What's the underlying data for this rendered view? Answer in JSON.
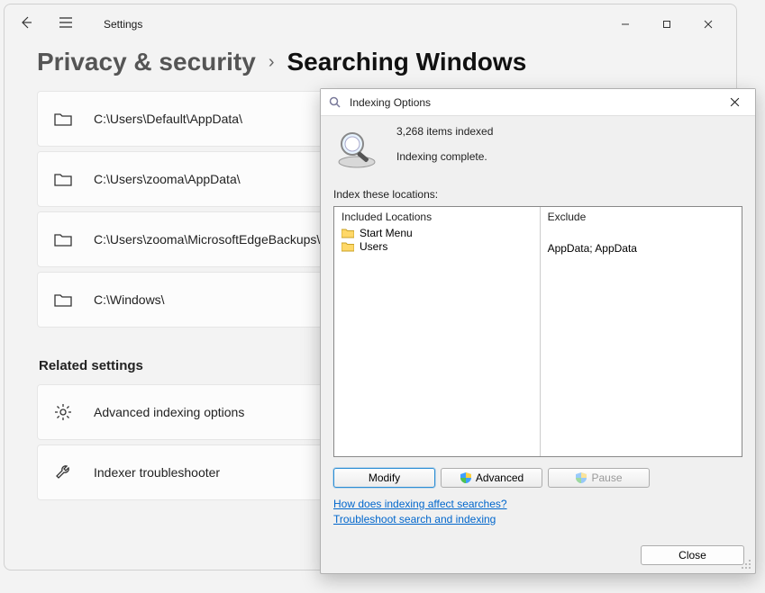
{
  "settings": {
    "app_title": "Settings",
    "breadcrumb_main": "Privacy & security",
    "breadcrumb_sep": "›",
    "breadcrumb_sub": "Searching Windows",
    "folders": [
      "C:\\Users\\Default\\AppData\\",
      "C:\\Users\\zooma\\AppData\\",
      "C:\\Users\\zooma\\MicrosoftEdgeBackups\\",
      "C:\\Windows\\"
    ],
    "related_heading": "Related settings",
    "related": [
      {
        "label": "Advanced indexing options",
        "icon": "gear"
      },
      {
        "label": "Indexer troubleshooter",
        "icon": "wrench"
      }
    ]
  },
  "dialog": {
    "title": "Indexing Options",
    "items_indexed": "3,268 items indexed",
    "status": "Indexing complete.",
    "subheader": "Index these locations:",
    "included_header": "Included Locations",
    "exclude_header": "Exclude",
    "included": [
      "Start Menu",
      "Users"
    ],
    "exclude": [
      "",
      "AppData; AppData"
    ],
    "buttons": {
      "modify": "Modify",
      "advanced": "Advanced",
      "pause": "Pause"
    },
    "links": {
      "how": "How does indexing affect searches?",
      "trouble": "Troubleshoot search and indexing"
    },
    "close": "Close"
  }
}
